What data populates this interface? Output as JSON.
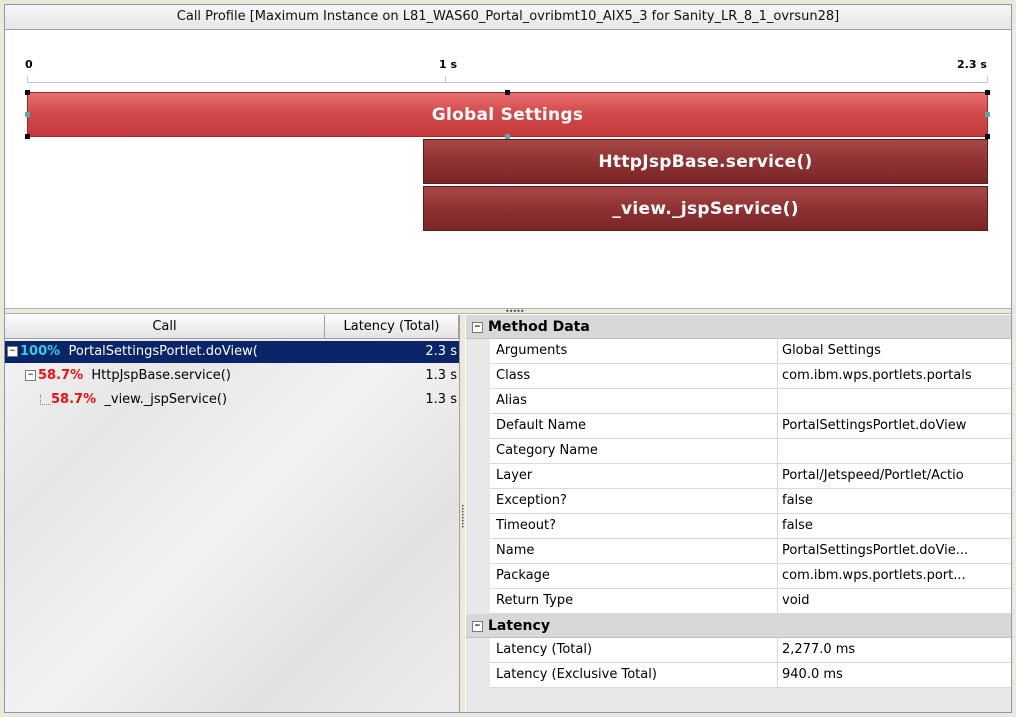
{
  "window": {
    "title": "Call Profile [Maximum Instance on L81_WAS60_Portal_ovribmt10_AIX5_3 for Sanity_LR_8_1_ovrsun28]"
  },
  "timeline": {
    "ticks": [
      "0",
      "1 s",
      "2.3 s"
    ],
    "bars": {
      "global": "Global Settings",
      "http": "HttpJspBase.service()",
      "view": "_view._jspService()"
    }
  },
  "call_tree": {
    "headers": {
      "call": "Call",
      "latency": "Latency (Total)"
    },
    "rows": [
      {
        "pct": "100%",
        "name": "PortalSettingsPortlet.doView(",
        "latency": "2.3 s",
        "toggle": "−"
      },
      {
        "pct": "58.7%",
        "name": "HttpJspBase.service()",
        "latency": "1.3 s",
        "toggle": "−"
      },
      {
        "pct": "58.7%",
        "name": "_view._jspService()",
        "latency": "1.3 s"
      }
    ]
  },
  "properties": {
    "method_data": {
      "label": "Method Data",
      "toggle": "−",
      "rows": [
        {
          "name": "Arguments",
          "value": "Global Settings"
        },
        {
          "name": "Class",
          "value": "com.ibm.wps.portlets.portals"
        },
        {
          "name": "Alias",
          "value": ""
        },
        {
          "name": "Default Name",
          "value": "PortalSettingsPortlet.doView"
        },
        {
          "name": "Category Name",
          "value": ""
        },
        {
          "name": "Layer",
          "value": "Portal/Jetspeed/Portlet/Actio"
        },
        {
          "name": "Exception?",
          "value": "false"
        },
        {
          "name": "Timeout?",
          "value": "false"
        },
        {
          "name": "Name",
          "value": "PortalSettingsPortlet.doVie..."
        },
        {
          "name": "Package",
          "value": "com.ibm.wps.portlets.port..."
        },
        {
          "name": "Return Type",
          "value": "void"
        }
      ]
    },
    "latency": {
      "label": "Latency",
      "toggle": "−",
      "rows": [
        {
          "name": "Latency (Total)",
          "value": "2,277.0 ms"
        },
        {
          "name": "Latency (Exclusive Total)",
          "value": "940.0 ms"
        }
      ]
    }
  },
  "colors": {
    "selection": "#0a246a",
    "pct_top": "#37c9e6",
    "pct_red": "#ee1111",
    "bar_global": "#d44b4b",
    "bar_child": "#8f3232"
  }
}
